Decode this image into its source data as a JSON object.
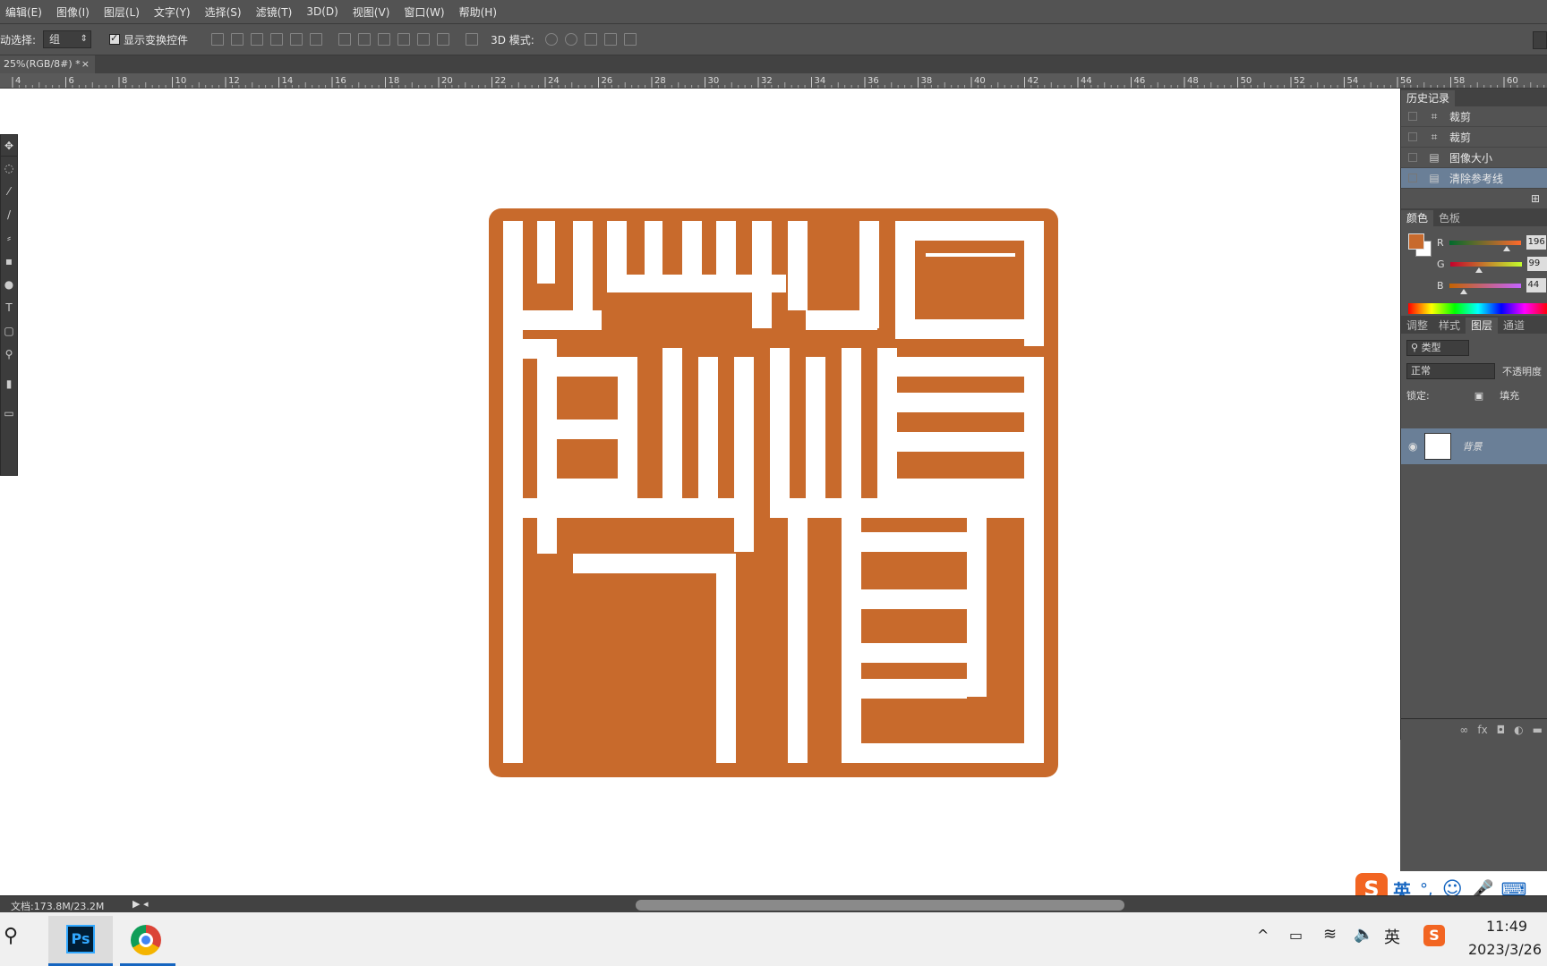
{
  "menu": [
    "编辑(E)",
    "图像(I)",
    "图层(L)",
    "文字(Y)",
    "选择(S)",
    "滤镜(T)",
    "3D(D)",
    "视图(V)",
    "窗口(W)",
    "帮助(H)"
  ],
  "options": {
    "auto_select_label": "动选择:",
    "auto_select_value": "组",
    "show_transform_label": "显示变换控件",
    "mode_3d_label": "3D 模式:"
  },
  "doc_tab": "25%(RGB/8#) *",
  "ruler_ticks": [
    "4",
    "6",
    "8",
    "10",
    "12",
    "14",
    "16",
    "18",
    "20",
    "22",
    "24",
    "26",
    "28",
    "30",
    "32",
    "34",
    "36",
    "38",
    "40",
    "42",
    "44",
    "46",
    "48",
    "50",
    "52",
    "54",
    "56",
    "58",
    "60"
  ],
  "history": {
    "tab": "历史记录",
    "items": [
      {
        "icon": "crop-icon",
        "label": "裁剪"
      },
      {
        "icon": "crop-icon",
        "label": "裁剪"
      },
      {
        "icon": "image-size-icon",
        "label": "图像大小"
      },
      {
        "icon": "image-size-icon",
        "label": "清除参考线"
      }
    ]
  },
  "color_panel": {
    "tabs": [
      "颜色",
      "色板"
    ],
    "foreground": "#c86a2c",
    "r_label": "R",
    "r_value": "196",
    "g_label": "G",
    "g_value": "99",
    "b_label": "B",
    "b_value": "44"
  },
  "layers_panel": {
    "tabs": [
      "调整",
      "样式",
      "图层",
      "通道"
    ],
    "filter": "类型",
    "blend": "正常",
    "opacity_label": "不透明度",
    "lock_label": "锁定:",
    "fill_label": "填充",
    "layer_name": "背景"
  },
  "status": {
    "doc_size": "文档:173.8M/23.2M"
  },
  "ime": {
    "lang": "英"
  },
  "taskbar": {
    "time": "11:49",
    "date": "2023/3/26",
    "tray_lang": "英"
  },
  "seal_color": "#c86a2c"
}
